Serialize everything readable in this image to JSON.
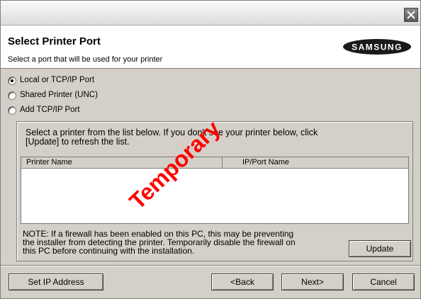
{
  "window": {
    "close_icon": "close-icon"
  },
  "header": {
    "title": "Select Printer Port",
    "subtitle": "Select a port that will be used for your printer",
    "logo_text": "SAMSUNG"
  },
  "port_options": [
    {
      "label": "Local or TCP/IP Port",
      "checked": true
    },
    {
      "label": "Shared Printer (UNC)",
      "checked": false
    },
    {
      "label": "Add TCP/IP Port",
      "checked": false
    }
  ],
  "panel": {
    "instructions_line1": "Select a printer from the list below. If you don't see your printer below, click",
    "instructions_line2": "[Update] to refresh the list.",
    "columns": [
      "Printer Name",
      "IP/Port Name"
    ],
    "rows": [],
    "note_line1": "NOTE: If a firewall has been enabled on this PC, this may be preventing",
    "note_line2": "the installer from detecting the printer. Temporarily disable the firewall on",
    "note_line3": "this PC before continuing with the installation.",
    "update_label": "Update"
  },
  "footer": {
    "set_ip_label": "Set IP Address",
    "back_label": "<Back",
    "next_label": "Next>",
    "cancel_label": "Cancel"
  },
  "watermark": "Temporary",
  "colors": {
    "dialog_bg": "#d4d0c8",
    "header_bg": "#ffffff",
    "watermark": "#ff0000",
    "logo": "#1a1a1a"
  }
}
